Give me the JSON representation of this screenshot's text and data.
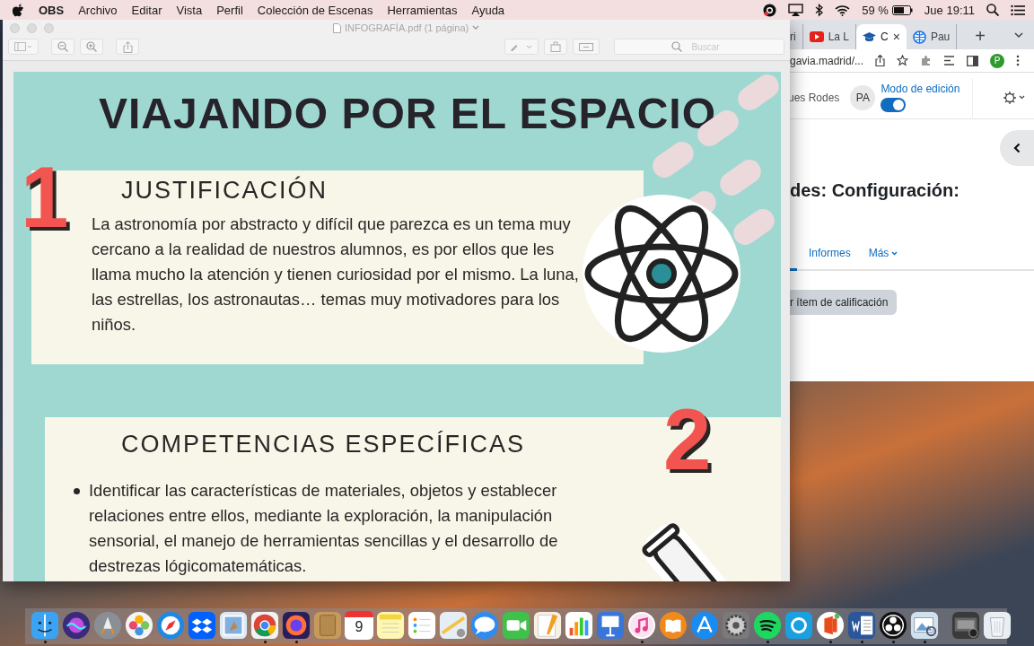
{
  "menubar": {
    "app": "OBS",
    "menus": [
      "Archivo",
      "Editar",
      "Vista",
      "Perfil",
      "Colección de Escenas",
      "Herramientas",
      "Ayuda"
    ],
    "battery": "59 %",
    "clock": "Jue 19:11"
  },
  "preview": {
    "title": "INFOGRAFÍA.pdf (1 página)",
    "search_placeholder": "Buscar",
    "page": {
      "title": "VIAJANDO POR EL ESPACIO",
      "sections": [
        {
          "kind": "paragraph",
          "number": "1",
          "heading": "JUSTIFICACIÓN",
          "text": "La astronomía por abstracto y difícil  que parezca es un tema muy cercano a la realidad de nuestros alumnos, es por ellos que les llama mucho la atención y tienen curiosidad por el mismo. La luna, las estrellas, los astronautas… temas muy motivadores para los niños."
        },
        {
          "kind": "bullets",
          "number": "2",
          "heading": "COMPETENCIAS ESPECÍFICAS",
          "items": [
            "Identificar las características de materiales, objetos y establecer relaciones entre ellos, mediante la exploración, la manipulación sensorial, el manejo de herramientas sencillas y el desarrollo de destrezas lógicomatemáticas."
          ]
        }
      ]
    }
  },
  "browser": {
    "tabs": [
      {
        "label": "ri",
        "selected": false
      },
      {
        "label": "La L",
        "selected": false
      },
      {
        "label": "C",
        "selected": true,
        "close": "×"
      },
      {
        "label": "Pau",
        "selected": false
      }
    ],
    "new_tab": "+",
    "url": "gavia.madrid/...",
    "profile": "P",
    "user": "ues Rodes",
    "avatar": "PA",
    "edit_mode": {
      "label": "Modo de edición",
      "on": true
    },
    "heading": "des: Configuración:",
    "nav": [
      {
        "label": "Informes",
        "dropdown": false
      },
      {
        "label": "Más",
        "dropdown": true
      }
    ],
    "action": "r ítem de calificación"
  },
  "dock": {
    "apps": [
      {
        "running": true
      },
      {
        "running": false
      },
      {
        "running": false
      },
      {
        "running": false
      },
      {
        "running": false
      },
      {
        "running": false
      },
      {
        "running": false
      },
      {
        "running": true
      },
      {
        "running": true
      },
      {
        "running": false
      },
      {
        "running": false,
        "label": "9"
      },
      {
        "running": false
      },
      {
        "running": false
      },
      {
        "running": false
      },
      {
        "running": false
      },
      {
        "running": false
      },
      {
        "running": false
      },
      {
        "running": false
      },
      {
        "running": false
      },
      {
        "running": true
      },
      {
        "running": false
      },
      {
        "running": false
      },
      {
        "running": false
      },
      {
        "running": true
      },
      {
        "running": false
      },
      {
        "running": true
      },
      {
        "running": true
      },
      {
        "running": true
      },
      {
        "running": true
      },
      {
        "running": false
      },
      {
        "running": false
      }
    ]
  }
}
